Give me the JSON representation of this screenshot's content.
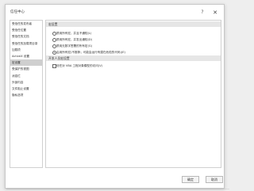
{
  "window": {
    "title": "信任中心"
  },
  "titlebar": {
    "help_label": "?",
    "close_label": "✕"
  },
  "sidebar": {
    "items": [
      {
        "label": "受信任的发布者"
      },
      {
        "label": "受信任位置"
      },
      {
        "label": "受信任的文档"
      },
      {
        "label": "受信任的加载项目录"
      },
      {
        "label": "加载项"
      },
      {
        "label": "ActiveX 设置"
      },
      {
        "label": "宏设置"
      },
      {
        "label": "受保护的视图"
      },
      {
        "label": "消息栏"
      },
      {
        "label": "外部内容"
      },
      {
        "label": "文件阻止设置"
      },
      {
        "label": "隐私选项"
      }
    ],
    "selected_index": 6
  },
  "macro_settings": {
    "header": "宏设置",
    "options": [
      {
        "label": "禁用所有宏，并且不通知(L)",
        "checked": false
      },
      {
        "label": "禁用所有宏，并发出通知(D)",
        "checked": false
      },
      {
        "label": "禁用无数字签署的所有宏(G)",
        "checked": false
      },
      {
        "label": "启用所有宏(不推荐；可能会运行有潜在危险的代码)(E)",
        "checked": true
      }
    ]
  },
  "developer_settings": {
    "header": "开发人员宏设置",
    "options": [
      {
        "label": "信任对 VBA 工程对象模型的访问(V)",
        "checked": false
      }
    ]
  },
  "footer": {
    "ok_label": "确定",
    "cancel_label": "取消"
  }
}
